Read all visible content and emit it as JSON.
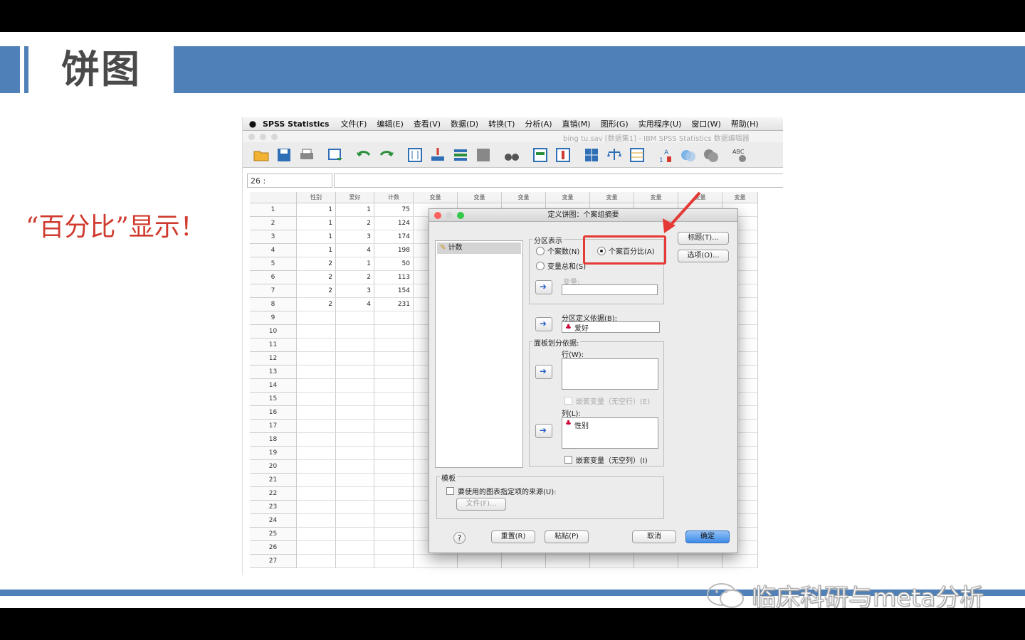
{
  "slide": {
    "title": "饼图",
    "subtitle": "“百分比”显示！",
    "watermark": "临床科研与meta分析"
  },
  "colors": {
    "accent": "#4f81b8",
    "subtitle": "#d03a2f",
    "highlight": "#e53935"
  },
  "spss": {
    "menubar": {
      "apple": "",
      "app": "SPSS Statistics",
      "items": [
        "文件(F)",
        "编辑(E)",
        "查看(V)",
        "数据(D)",
        "转换(T)",
        "分析(A)",
        "直销(M)",
        "图形(G)",
        "实用程序(U)",
        "窗口(W)",
        "帮助(H)"
      ]
    },
    "window_title": "bing tu.sav [数据集1] - IBM SPSS Statistics 数据编辑器",
    "cell_ref": "26 :",
    "columns": [
      "性别",
      "爱好",
      "计数",
      "变量",
      "变量",
      "变量",
      "变量",
      "变量",
      "变量",
      "变量",
      "变量"
    ],
    "rows": [
      [
        "1",
        "1",
        "1",
        "75"
      ],
      [
        "2",
        "1",
        "2",
        "124"
      ],
      [
        "3",
        "1",
        "3",
        "174"
      ],
      [
        "4",
        "1",
        "4",
        "198"
      ],
      [
        "5",
        "2",
        "1",
        "50"
      ],
      [
        "6",
        "2",
        "2",
        "113"
      ],
      [
        "7",
        "2",
        "3",
        "154"
      ],
      [
        "8",
        "2",
        "4",
        "231"
      ],
      [
        "9",
        "",
        "",
        ""
      ],
      [
        "10",
        "",
        "",
        ""
      ],
      [
        "11",
        "",
        "",
        ""
      ],
      [
        "12",
        "",
        "",
        ""
      ],
      [
        "13",
        "",
        "",
        ""
      ],
      [
        "14",
        "",
        "",
        ""
      ],
      [
        "15",
        "",
        "",
        ""
      ],
      [
        "16",
        "",
        "",
        ""
      ],
      [
        "17",
        "",
        "",
        ""
      ],
      [
        "18",
        "",
        "",
        ""
      ],
      [
        "19",
        "",
        "",
        ""
      ],
      [
        "20",
        "",
        "",
        ""
      ],
      [
        "21",
        "",
        "",
        ""
      ],
      [
        "22",
        "",
        "",
        ""
      ],
      [
        "23",
        "",
        "",
        ""
      ],
      [
        "24",
        "",
        "",
        ""
      ],
      [
        "25",
        "",
        "",
        ""
      ],
      [
        "26",
        "",
        "",
        ""
      ],
      [
        "27",
        "",
        "",
        ""
      ]
    ],
    "dialog": {
      "title": "定义饼图：个案组摘要",
      "variable_list": [
        "计数"
      ],
      "slices_group": "分区表示",
      "radio_cases": "个案数(N)",
      "radio_percent": "个案百分比(A)",
      "radio_sum": "变量总和(S)",
      "variable_label": "变量:",
      "define_slices_label": "分区定义依据(B):",
      "define_slices_value": "爱好",
      "panel_group": "面板划分依据:",
      "rows_label": "行(W):",
      "nest_rows": "嵌套变量（无空行）(E)",
      "cols_label": "列(L):",
      "cols_value": "性别",
      "nest_cols": "嵌套变量（无空列）(I)",
      "template_group": "模板",
      "template_check": "要使用的图表指定项的来源(U):",
      "file_button": "文件(F)...",
      "title_button": "标题(T)...",
      "options_button": "选项(O)...",
      "help_button": "?",
      "reset_button": "重置(R)",
      "paste_button": "粘贴(P)",
      "cancel_button": "取消",
      "ok_button": "确定"
    }
  }
}
